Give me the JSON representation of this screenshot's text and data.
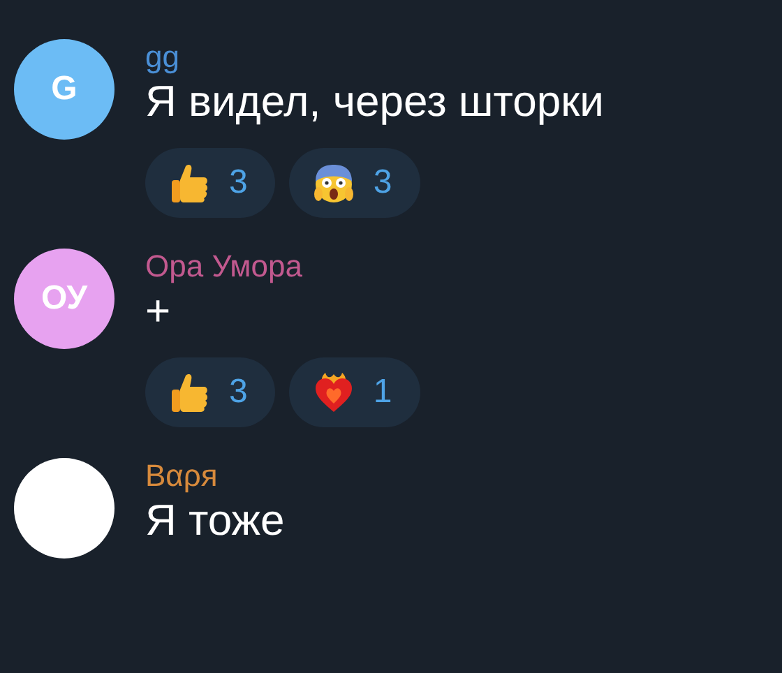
{
  "messages": [
    {
      "author": "gg",
      "color": "#4a8fd6",
      "avatar": {
        "initials": "G",
        "color": "#6cbcf5"
      },
      "text": "Я видел, через шторки",
      "reactions": [
        {
          "kind": "thumbs-up",
          "count": "3"
        },
        {
          "kind": "scream",
          "count": "3"
        }
      ]
    },
    {
      "author": "Ора Умора",
      "color": "#c2598f",
      "avatar": {
        "initials": "ОУ",
        "color": "#e7a2f0"
      },
      "text": "+",
      "reactions": [
        {
          "kind": "thumbs-up",
          "count": "3"
        },
        {
          "kind": "heart-fire",
          "count": "1"
        }
      ]
    },
    {
      "author": "Вαρя",
      "color": "#d78a3c",
      "avatar": {
        "color": "#ffffff"
      },
      "text": "Я тоже"
    }
  ]
}
